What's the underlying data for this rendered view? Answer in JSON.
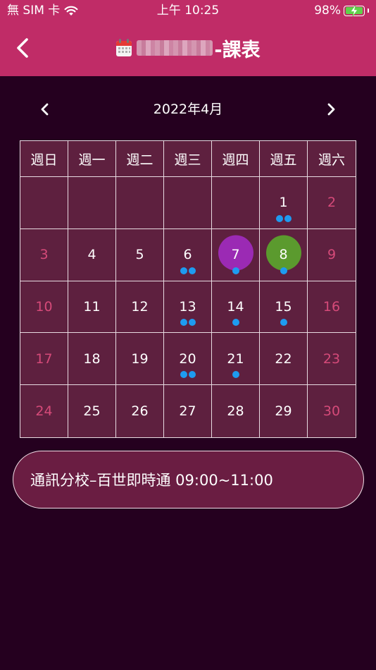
{
  "status_bar": {
    "carrier": "無 SIM 卡",
    "time": "上午 10:25",
    "battery": "98%",
    "battery_level": 0.98
  },
  "nav": {
    "title_suffix": "-課表",
    "back_icon": "chevron-left-icon",
    "title_icon": "calendar-icon"
  },
  "calendar": {
    "month_label": "2022年4月",
    "weekdays": [
      "週日",
      "週一",
      "週二",
      "週三",
      "週四",
      "週五",
      "週六"
    ],
    "weeks": [
      [
        null,
        null,
        null,
        null,
        null,
        {
          "day": "1",
          "dots": 2
        },
        {
          "day": "2",
          "dots": 0
        }
      ],
      [
        {
          "day": "3",
          "dots": 0
        },
        {
          "day": "4",
          "dots": 0
        },
        {
          "day": "5",
          "dots": 0
        },
        {
          "day": "6",
          "dots": 2
        },
        {
          "day": "7",
          "dots": 1,
          "highlight": "#9b2ab4"
        },
        {
          "day": "8",
          "dots": 1,
          "highlight": "#5b9a2e"
        },
        {
          "day": "9",
          "dots": 0
        }
      ],
      [
        {
          "day": "10",
          "dots": 0
        },
        {
          "day": "11",
          "dots": 0
        },
        {
          "day": "12",
          "dots": 0
        },
        {
          "day": "13",
          "dots": 2
        },
        {
          "day": "14",
          "dots": 1
        },
        {
          "day": "15",
          "dots": 1
        },
        {
          "day": "16",
          "dots": 0
        }
      ],
      [
        {
          "day": "17",
          "dots": 0
        },
        {
          "day": "18",
          "dots": 0
        },
        {
          "day": "19",
          "dots": 0
        },
        {
          "day": "20",
          "dots": 2
        },
        {
          "day": "21",
          "dots": 1
        },
        {
          "day": "22",
          "dots": 0
        },
        {
          "day": "23",
          "dots": 0
        }
      ],
      [
        {
          "day": "24",
          "dots": 0
        },
        {
          "day": "25",
          "dots": 0
        },
        {
          "day": "26",
          "dots": 0
        },
        {
          "day": "27",
          "dots": 0
        },
        {
          "day": "28",
          "dots": 0
        },
        {
          "day": "29",
          "dots": 0
        },
        {
          "day": "30",
          "dots": 0
        }
      ]
    ]
  },
  "event": {
    "text": "通訊分校–百世即時通 09:00~11:00"
  },
  "colors": {
    "header_bg": "#c02c67",
    "page_bg": "#25001f",
    "grid_bg": "#5e203f",
    "weekend_text": "#d54a79",
    "dot": "#1e9bf0",
    "today_circle": "#9b2ab4",
    "selected_circle": "#5b9a2e"
  }
}
